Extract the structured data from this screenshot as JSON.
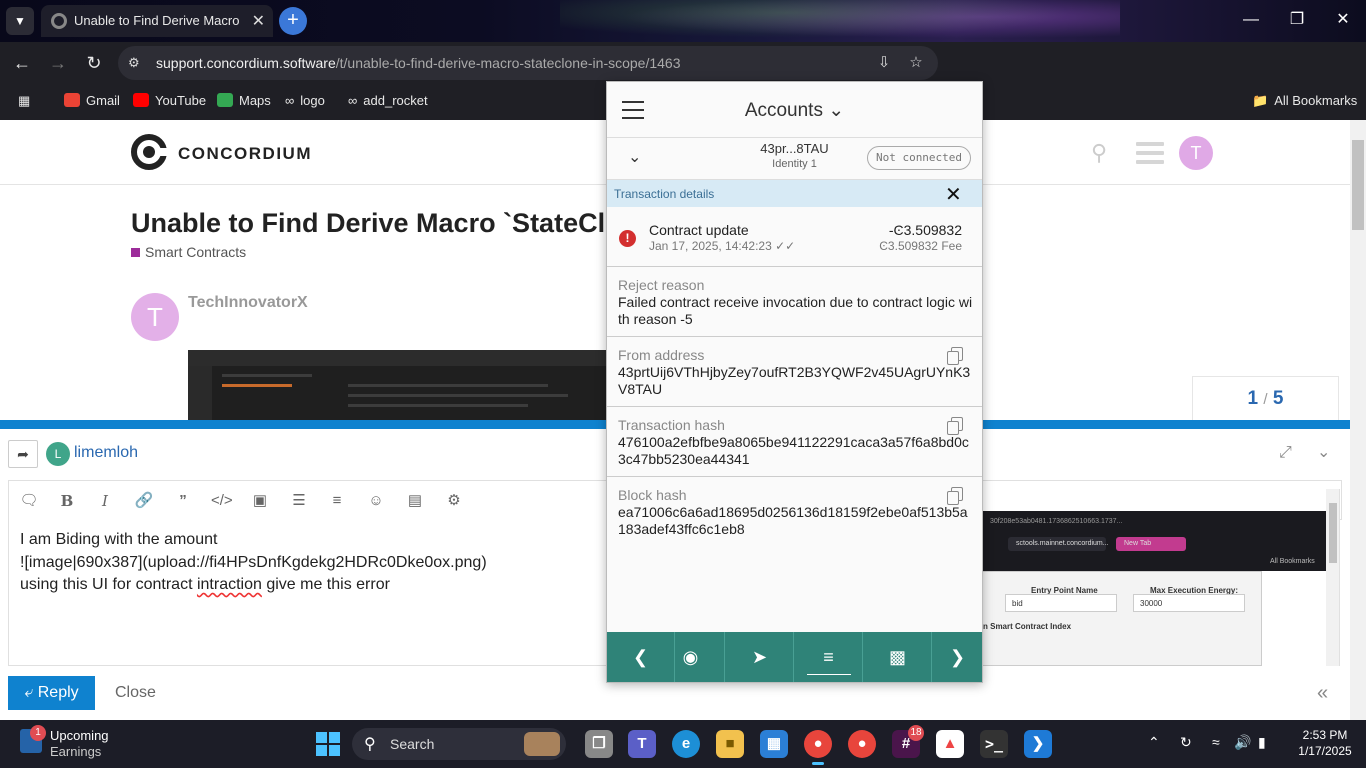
{
  "browser": {
    "tab_title": "Unable to Find Derive Macro `StateClone` in Scope",
    "url_domain": "support.concordium.software",
    "url_path": "/t/unable-to-find-derive-macro-stateclone-in-scope/1463",
    "bookmarks": [
      {
        "label": "Gmail",
        "icon": "gmail-icon",
        "color": "#ea4335"
      },
      {
        "label": "YouTube",
        "icon": "youtube-icon",
        "color": "#ff0000"
      },
      {
        "label": "Maps",
        "icon": "maps-icon",
        "color": "#34a853"
      },
      {
        "label": "logo",
        "icon": "link-icon",
        "color": "#888888"
      },
      {
        "label": "add_rocket",
        "icon": "link-icon",
        "color": "#888888"
      }
    ],
    "all_bookmarks": "All Bookmarks"
  },
  "site": {
    "logo_text": "CONCORDIUM",
    "avatar_letter": "T",
    "topic_title": "Unable to Find Derive Macro `StateClone` in Scope",
    "category": "Smart Contracts",
    "category_color": "#9c2c9a",
    "post_author": "TechInnovatorX",
    "post_avatar_letter": "T",
    "timeline_current": "1",
    "timeline_sep": "/",
    "timeline_total": "5"
  },
  "composer": {
    "reply_to_letter": "L",
    "reply_to_user": "limemloh",
    "editor_lines": [
      "I am Biding with the amount",
      "![image|690x387](upload://fi4HPsDnfKgdekg2HDRc0Dke0ox.png)",
      "using this UI for contract "
    ],
    "misspelled": "intraction",
    "line3_tail": " give me this error",
    "reply_label": "Reply",
    "close_label": "Close",
    "preview": {
      "tab1": "sctools.mainnet.concordium...",
      "tab2": "New Tab",
      "address_text": "30f208e53ab0481.1736862510663.1737...",
      "all_bookmarks": "All Bookmarks",
      "entry_point_label": "Entry Point Name",
      "entry_point_value": "bid",
      "max_energy_label": "Max Execution Energy:",
      "max_energy_value": "30000",
      "index_label": "n Smart Contract Index"
    }
  },
  "wallet": {
    "title": "Accounts",
    "account_name": "43pr...8TAU",
    "identity": "Identity 1",
    "connection_status": "Not connected",
    "details_label": "Transaction details",
    "tx_type": "Contract update",
    "tx_date": "Jan 17, 2025, 14:42:23",
    "tx_amount": "-Ͼ3.509832",
    "tx_fee": "Ͼ3.509832 Fee",
    "fields": [
      {
        "key": "Reject reason",
        "value": "Failed contract receive invocation due to contract logic with reason -5",
        "copy": false
      },
      {
        "key": "From address",
        "value": "43prtUij6VThHjbyZey7oufRT2B3YQWF2v45UAgrUYnK3V8TAU",
        "copy": true
      },
      {
        "key": "Transaction hash",
        "value": "476100a2efbfbe9a8065be941122291caca3a57f6a8bd0c3c47bb5230ea44341",
        "copy": true
      },
      {
        "key": "Block hash",
        "value": "ea71006c6a6ad18695d0256136d18159f2ebe0af513b5a183adef43ffc6c1eb8",
        "copy": true
      }
    ],
    "accent_color": "#2f8378"
  },
  "taskbar": {
    "widget_title": "Upcoming",
    "widget_subtitle": "Earnings",
    "widget_badge": "1",
    "search_label": "Search",
    "slack_badge": "18",
    "time": "2:53 PM",
    "date": "1/17/2025"
  }
}
